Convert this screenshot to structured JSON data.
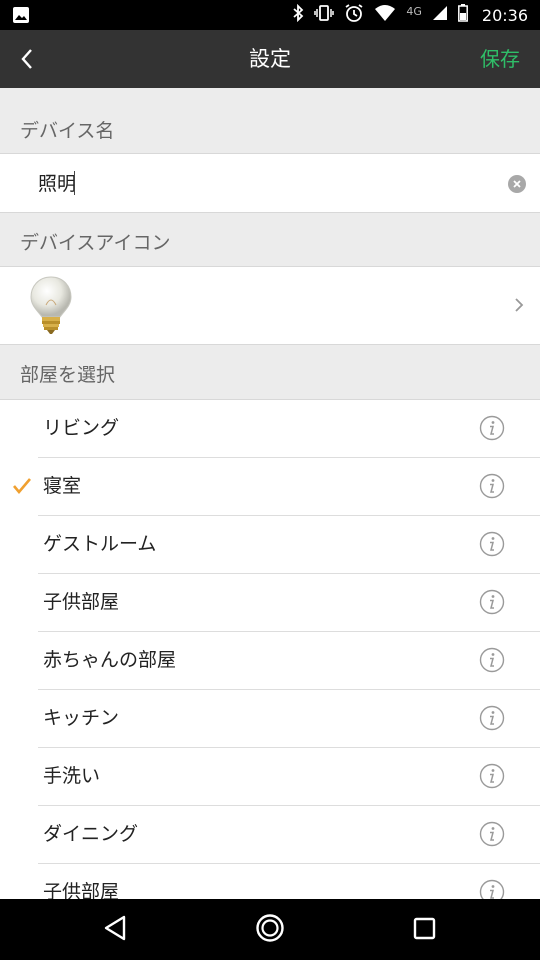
{
  "status_bar": {
    "network": "4G",
    "time": "20:36",
    "icons": [
      "image-icon",
      "bluetooth-icon",
      "vibrate-icon",
      "alarm-icon",
      "wifi-icon",
      "signal-icon",
      "battery-icon"
    ]
  },
  "header": {
    "title": "設定",
    "save_label": "保存",
    "save_color": "#2fbe68"
  },
  "device_name": {
    "section_label": "デバイス名",
    "value": "照明"
  },
  "device_icon": {
    "section_label": "デバイスアイコン",
    "icon": "light-bulb-icon"
  },
  "room_select": {
    "section_label": "部屋を選択",
    "check_color": "#f0a030",
    "rooms": [
      {
        "label": "リビング",
        "selected": false
      },
      {
        "label": "寝室",
        "selected": true
      },
      {
        "label": "ゲストルーム",
        "selected": false
      },
      {
        "label": "子供部屋",
        "selected": false
      },
      {
        "label": "赤ちゃんの部屋",
        "selected": false
      },
      {
        "label": "キッチン",
        "selected": false
      },
      {
        "label": "手洗い",
        "selected": false
      },
      {
        "label": "ダイニング",
        "selected": false
      },
      {
        "label": "子供部屋",
        "selected": false
      }
    ]
  }
}
